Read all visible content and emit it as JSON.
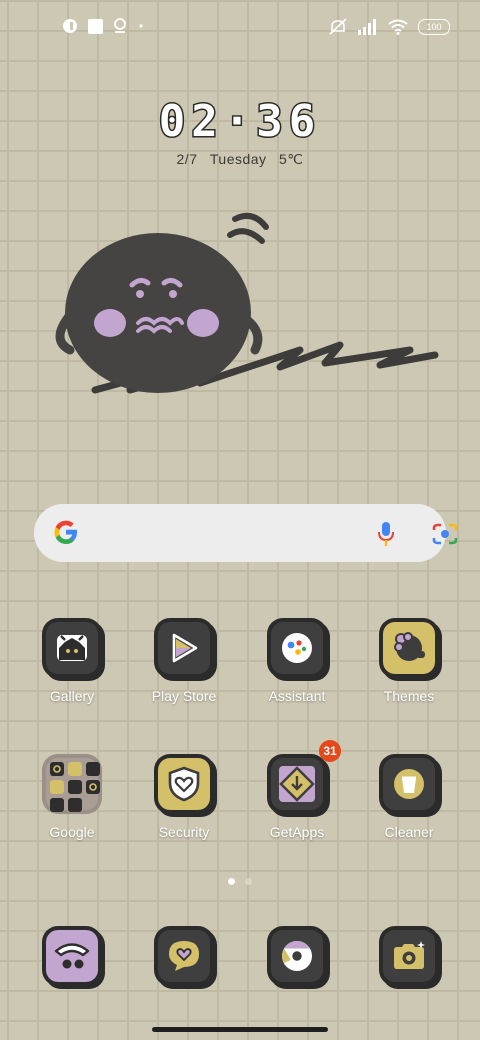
{
  "status_bar": {
    "left_icons": [
      "app-notification-icon",
      "square-notification-icon",
      "location-pin-icon",
      "dot-icon"
    ],
    "right_icons": [
      "mute-icon",
      "signal-icon",
      "wifi-icon"
    ],
    "battery_level": "100"
  },
  "clock": {
    "time": "02·36",
    "date": "2/7",
    "day": "Tuesday",
    "temperature": "5℃"
  },
  "search_bar": {
    "icons": [
      "google-icon",
      "microphone-icon",
      "lens-icon"
    ]
  },
  "apps_row1": [
    {
      "label": "Gallery",
      "icon": "gallery-icon"
    },
    {
      "label": "Play Store",
      "icon": "play-store-icon"
    },
    {
      "label": "Assistant",
      "icon": "assistant-icon"
    },
    {
      "label": "Themes",
      "icon": "themes-icon"
    }
  ],
  "apps_row2": [
    {
      "label": "Google",
      "icon": "google-folder-icon"
    },
    {
      "label": "Security",
      "icon": "security-icon"
    },
    {
      "label": "GetApps",
      "icon": "getapps-icon",
      "badge": "31"
    },
    {
      "label": "Cleaner",
      "icon": "cleaner-icon"
    }
  ],
  "page_indicator": {
    "pages": 2,
    "current": 1
  },
  "dock": [
    {
      "icon": "phone-icon"
    },
    {
      "icon": "messages-icon"
    },
    {
      "icon": "chrome-icon"
    },
    {
      "icon": "camera-icon"
    }
  ],
  "colors": {
    "wallpaper": "#cdc8b4",
    "grid": "#bfb9a4",
    "tile_dark": "#3d3d3d",
    "tile_yellow": "#d5c06a",
    "tile_purple": "#c2a6cf",
    "badge": "#e4481c"
  }
}
